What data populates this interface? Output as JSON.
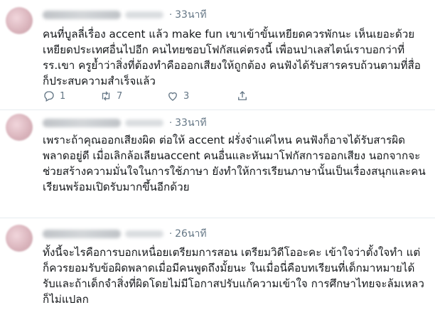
{
  "tweets": [
    {
      "time": "33นาที",
      "text": "คนที่บูลลี่เรื่อง accent แล้ว make fun เขาเข้าขั้นเหยียดควรพักนะ เห็นเยอะด้วย เหยียดประเทศอื่นไปอีก คนไทยชอบโฟกัสแค่ตรงนี้ เพื่อนปาเลสไตน์เราบอกว่าที่รร.เขา ครูย้ำว่าสิ่งที่ต้องทำคือออกเสียงให้ถูกต้อง คนฟังได้รับสารครบถ้วนตามที่สื่อก็ประสบความสำเร็จแล้ว",
      "replies": "1",
      "retweets": "7",
      "likes": "3"
    },
    {
      "time": "33นาที",
      "text": "เพราะถ้าคุณออกเสียงผิด ต่อให้ accent ฝรั่งจ๋าแค่ไหน คนฟังก็อาจได้รับสารผิดพลาดอยู่ดี เมื่อเลิกล้อเลียนaccent คนอื่นและหันมาโฟกัสการออกเสียง นอกจากจะช่วยสร้างความมั่นใจในการใช้ภาษา ยังทำให้การเรียนภาษานั้นเป็นเรื่องสนุกและคนเรียนพร้อมเปิดรับมากขึ้นอีกด้วย"
    },
    {
      "time": "26นาที",
      "text": "ทั้งนี้จะไรคือการบอกเหนื่อยเตรียมการสอน เตรียมวิดีโออะคะ เข้าใจว่าตั้งใจทำ แต่ก็ควรยอมรับข้อผิดพลาดเมื่อมีคนพูดถึงมั้ยนะ ในเมื่อนี่คือบทเรียนที่เด็กมาหมายได้รับและถ้าเด็กจำสิ่งที่ผิดโดยไม่มีโอกาสปรับแก้ความเข้าใจ การศึกษาไทยจะล้มเหลวก็ไม่แปลก"
    }
  ],
  "icons": [
    "reply-icon",
    "retweet-icon",
    "like-icon",
    "share-icon"
  ]
}
